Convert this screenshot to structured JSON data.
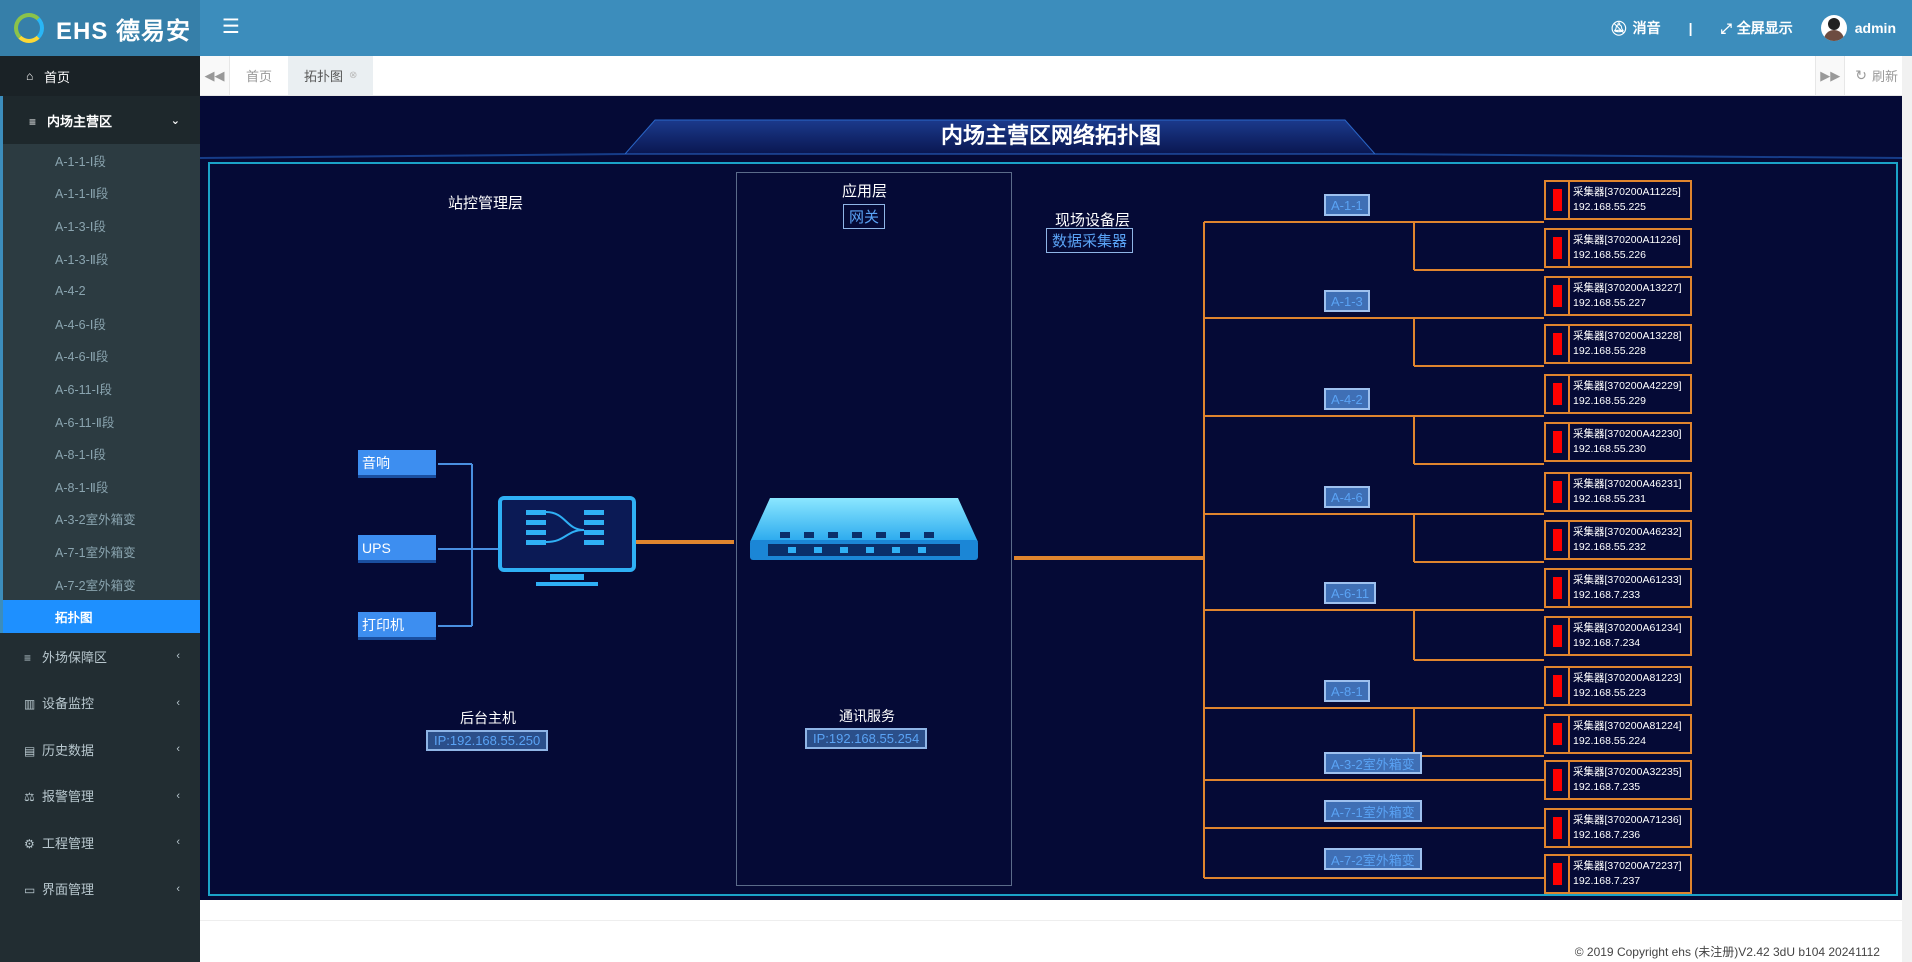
{
  "header": {
    "logo_text": "EHS 德易安",
    "menu_icon": "bars-icon",
    "mute_label": "消音",
    "separator": "|",
    "fullscreen_label": "全屏显示",
    "user_name": "admin"
  },
  "sidebar": {
    "home": "首页",
    "group_label": "内场主营区",
    "sub_items": [
      "A-1-1-Ⅰ段",
      "A-1-1-Ⅱ段",
      "A-1-3-Ⅰ段",
      "A-1-3-Ⅱ段",
      "A-4-2",
      "A-4-6-Ⅰ段",
      "A-4-6-Ⅱ段",
      "A-6-11-Ⅰ段",
      "A-6-11-Ⅱ段",
      "A-8-1-Ⅰ段",
      "A-8-1-Ⅱ段",
      "A-3-2室外箱变",
      "A-7-1室外箱变",
      "A-7-2室外箱变",
      "拓扑图"
    ],
    "items": [
      "外场保障区",
      "设备监控",
      "历史数据",
      "报警管理",
      "工程管理",
      "界面管理"
    ]
  },
  "tabs": {
    "items": [
      "首页",
      "拓扑图"
    ],
    "refresh": "刷新"
  },
  "topology": {
    "title": "内场主营区网络拓扑图",
    "station_layer": "站控管理层",
    "app_layer": "应用层",
    "gateway": "网关",
    "field_layer": "现场设备层",
    "collector_label": "数据采集器",
    "devices": [
      "音响",
      "UPS",
      "打印机"
    ],
    "host_label": "后台主机",
    "host_ip": "IP:192.168.55.250",
    "comm_label": "通讯服务",
    "comm_ip": "IP:192.168.55.254",
    "branches": [
      "A-1-1",
      "A-1-3",
      "A-4-2",
      "A-4-6",
      "A-6-11",
      "A-8-1",
      "A-3-2室外箱变",
      "A-7-1室外箱变",
      "A-7-2室外箱变"
    ],
    "collectors": [
      {
        "name": "采集器[370200A11225]",
        "ip": "192.168.55.225"
      },
      {
        "name": "采集器[370200A11226]",
        "ip": "192.168.55.226"
      },
      {
        "name": "采集器[370200A13227]",
        "ip": "192.168.55.227"
      },
      {
        "name": "采集器[370200A13228]",
        "ip": "192.168.55.228"
      },
      {
        "name": "采集器[370200A42229]",
        "ip": "192.168.55.229"
      },
      {
        "name": "采集器[370200A42230]",
        "ip": "192.168.55.230"
      },
      {
        "name": "采集器[370200A46231]",
        "ip": "192.168.55.231"
      },
      {
        "name": "采集器[370200A46232]",
        "ip": "192.168.55.232"
      },
      {
        "name": "采集器[370200A61233]",
        "ip": "192.168.7.233"
      },
      {
        "name": "采集器[370200A61234]",
        "ip": "192.168.7.234"
      },
      {
        "name": "采集器[370200A81223]",
        "ip": "192.168.55.223"
      },
      {
        "name": "采集器[370200A81224]",
        "ip": "192.168.55.224"
      },
      {
        "name": "采集器[370200A32235]",
        "ip": "192.168.7.235"
      },
      {
        "name": "采集器[370200A71236]",
        "ip": "192.168.7.236"
      },
      {
        "name": "采集器[370200A72237]",
        "ip": "192.168.7.237"
      }
    ]
  },
  "footer": {
    "copyright": "© 2019 Copyright ehs (未注册)V2.42 3dU b104 20241112"
  },
  "colors": {
    "header": "#3c8dbc",
    "sidebar": "#222d32",
    "canvas": "#050a36",
    "link_orange": "#e0852e",
    "link_blue": "#4a8fe0",
    "alarm": "#ff0000"
  }
}
